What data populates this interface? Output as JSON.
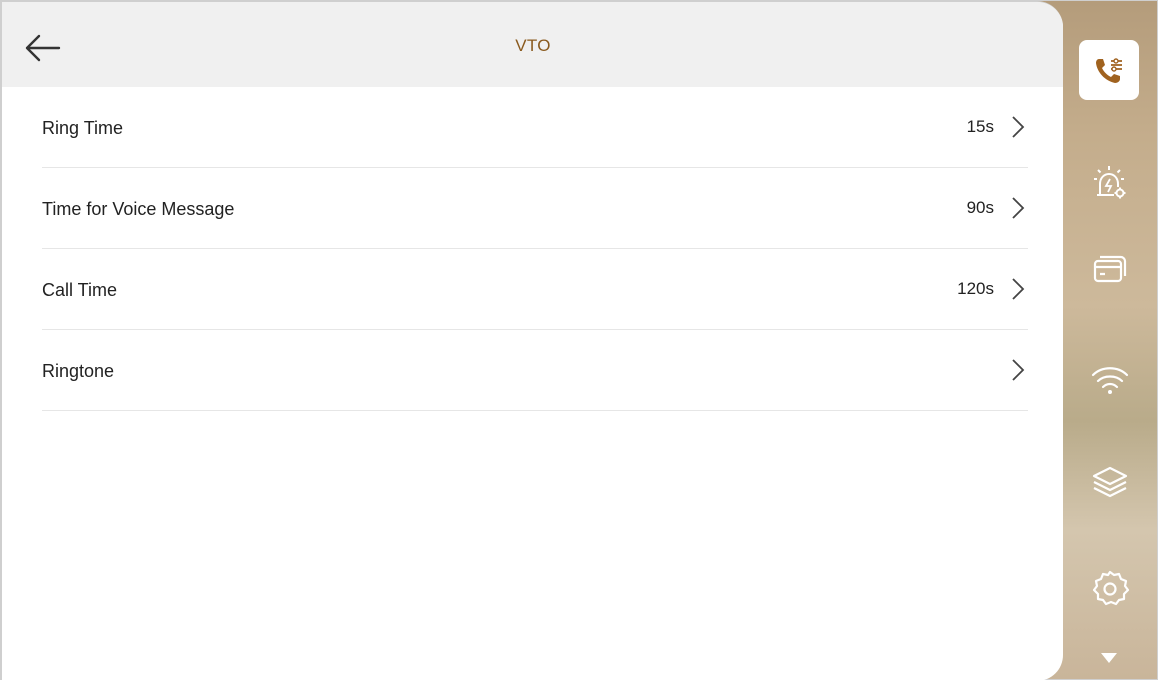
{
  "header": {
    "title": "VTO"
  },
  "settings": [
    {
      "label": "Ring Time",
      "value": "15s"
    },
    {
      "label": "Time for Voice Message",
      "value": "90s"
    },
    {
      "label": "Call Time",
      "value": "120s"
    },
    {
      "label": "Ringtone",
      "value": ""
    }
  ],
  "sidebar": {
    "items": [
      {
        "icon": "call-settings-icon",
        "active": true
      },
      {
        "icon": "alarm-settings-icon",
        "active": false
      },
      {
        "icon": "card-icon",
        "active": false
      },
      {
        "icon": "wifi-icon",
        "active": false
      },
      {
        "icon": "layers-icon",
        "active": false
      },
      {
        "icon": "gear-icon",
        "active": false
      }
    ]
  },
  "colors": {
    "title": "#8a5a1e",
    "active_icon": "#a0621f",
    "header_bg": "#f0f0f0"
  }
}
